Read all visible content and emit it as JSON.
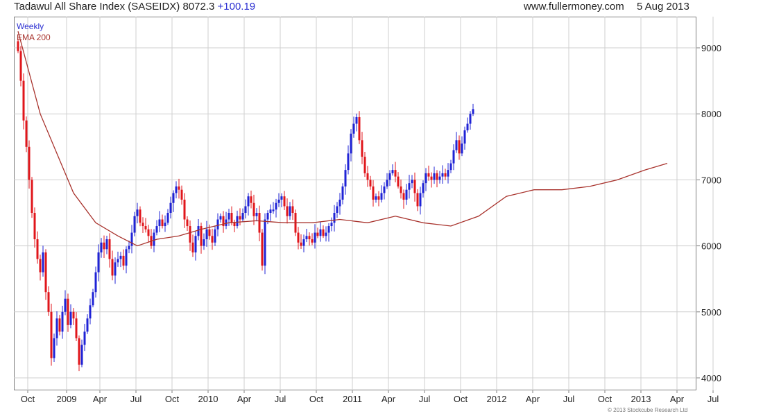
{
  "header": {
    "title": "Tadawul All Share Index (SASEIDX) 8072.3",
    "change": "+100.19",
    "site": "www.fullermoney.com",
    "date": "5 Aug 2013"
  },
  "legend": {
    "period": "Weekly",
    "indicator": "EMA 200"
  },
  "copyright": "© 2013 Stockcube Research Ltd",
  "colors": {
    "up": "#1f23d6",
    "down": "#e0161b",
    "ema": "#a8322c",
    "grid": "#cfcfcf",
    "frame": "#7f7f7f"
  },
  "chart_data": {
    "type": "candlestick",
    "title": "Tadawul All Share Index (SASEIDX) 8072.3 +100.19",
    "frequency": "Weekly",
    "ylim": [
      3850,
      9500
    ],
    "y_ticks": [
      4000,
      5000,
      6000,
      7000,
      8000,
      9000
    ],
    "y_axis_side": "right",
    "x_tick_labels": [
      "Oct",
      "2009",
      "Apr",
      "Jul",
      "Oct",
      "2010",
      "Apr",
      "Jul",
      "Oct",
      "2011",
      "Apr",
      "Jul",
      "Oct",
      "2012",
      "Apr",
      "Jul",
      "Oct",
      "2013",
      "Apr",
      "Jul"
    ],
    "x_tick_label_weeks": [
      4,
      18,
      30,
      43,
      56,
      69,
      82,
      95,
      108,
      121,
      134,
      147,
      160,
      173,
      186,
      199,
      212,
      225,
      238,
      251
    ],
    "grid": true,
    "legend": [
      "Weekly",
      "EMA 200"
    ],
    "ohlc_series": {
      "name": "Weekly",
      "closes": [
        8950,
        8500,
        7900,
        7500,
        7000,
        6500,
        6100,
        5800,
        5600,
        5900,
        5300,
        5000,
        4300,
        4600,
        4900,
        4700,
        5000,
        5200,
        4800,
        5000,
        4900,
        4600,
        4200,
        4500,
        4700,
        4900,
        5100,
        5300,
        5600,
        5900,
        6050,
        5950,
        6100,
        5800,
        5550,
        5750,
        5800,
        5850,
        5700,
        5950,
        6000,
        6200,
        6450,
        6550,
        6350,
        6300,
        6250,
        6150,
        6000,
        6200,
        6300,
        6400,
        6300,
        6350,
        6500,
        6650,
        6800,
        6900,
        6850,
        6700,
        6400,
        6300,
        6050,
        5900,
        6150,
        6300,
        6000,
        6100,
        6250,
        6150,
        6050,
        6250,
        6400,
        6450,
        6300,
        6400,
        6500,
        6350,
        6300,
        6450,
        6400,
        6500,
        6600,
        6750,
        6650,
        6450,
        6500,
        6200,
        5700,
        6400,
        6500,
        6550,
        6550,
        6650,
        6700,
        6750,
        6600,
        6450,
        6600,
        6500,
        6200,
        6050,
        6000,
        6100,
        6150,
        6100,
        6050,
        6200,
        6150,
        6250,
        6150,
        6200,
        6300,
        6350,
        6500,
        6600,
        6700,
        6900,
        7150,
        7400,
        7700,
        7850,
        7950,
        7600,
        7350,
        7100,
        7000,
        6900,
        6700,
        6750,
        6700,
        6800,
        6900,
        7000,
        7100,
        7150,
        7050,
        6900,
        6800,
        6700,
        6850,
        6950,
        7000,
        6800,
        6600,
        6800,
        6950,
        7100,
        7050,
        7000,
        7100,
        7000,
        7050,
        7100,
        7050,
        7150,
        7250,
        7450,
        7600,
        7400,
        7550,
        7750,
        7850,
        8000,
        8072
      ],
      "note": "weekly closes approximated from the chart; one value per weekly candle"
    },
    "ema_series": {
      "name": "EMA 200",
      "points": [
        [
          0,
          9250
        ],
        [
          8,
          8000
        ],
        [
          20,
          6800
        ],
        [
          28,
          6350
        ],
        [
          36,
          6150
        ],
        [
          43,
          6000
        ],
        [
          50,
          6100
        ],
        [
          58,
          6150
        ],
        [
          66,
          6250
        ],
        [
          76,
          6350
        ],
        [
          86,
          6380
        ],
        [
          96,
          6350
        ],
        [
          106,
          6350
        ],
        [
          116,
          6400
        ],
        [
          126,
          6350
        ],
        [
          136,
          6450
        ],
        [
          146,
          6350
        ],
        [
          156,
          6300
        ],
        [
          166,
          6450
        ],
        [
          176,
          6750
        ],
        [
          186,
          6850
        ],
        [
          196,
          6850
        ],
        [
          206,
          6900
        ],
        [
          216,
          7000
        ],
        [
          226,
          7150
        ],
        [
          234,
          7250
        ]
      ]
    }
  }
}
